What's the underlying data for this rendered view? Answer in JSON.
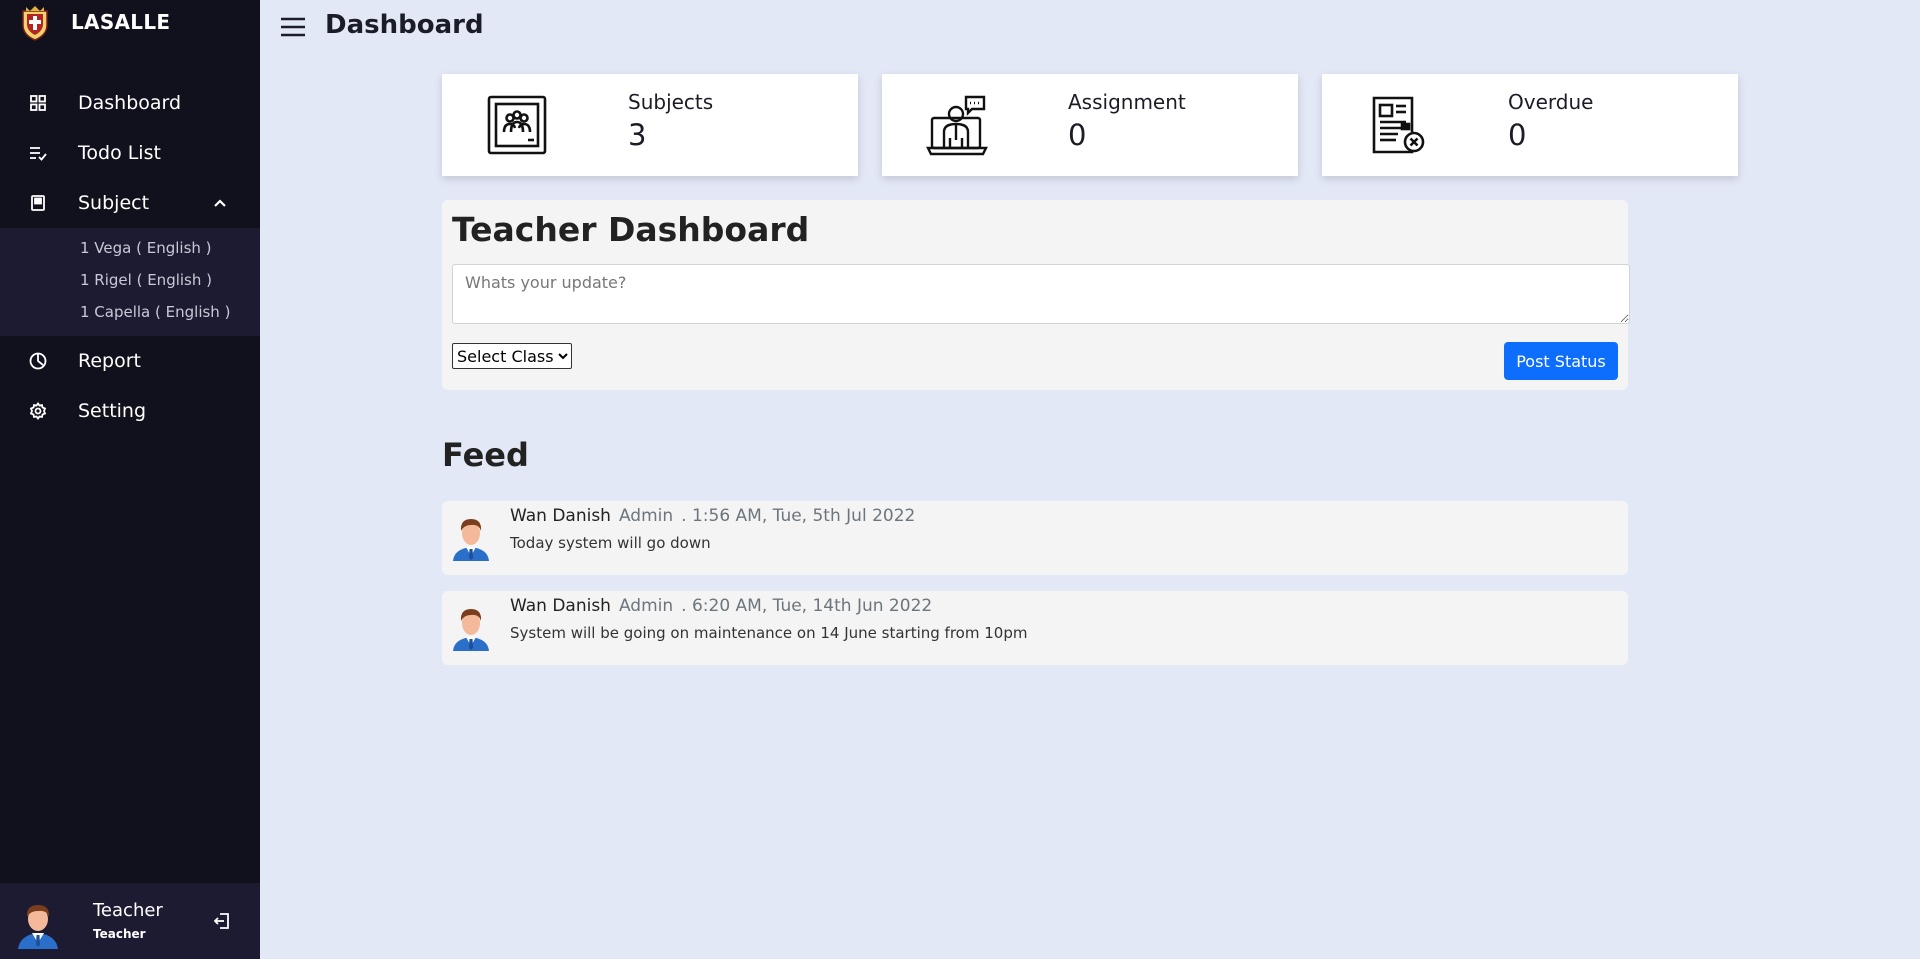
{
  "brand": {
    "name": "LASALLE"
  },
  "sidebar": {
    "items": [
      {
        "label": "Dashboard",
        "icon": "grid-icon"
      },
      {
        "label": "Todo List",
        "icon": "list-check-icon"
      },
      {
        "label": "Subject",
        "icon": "book-icon",
        "expanded": true
      },
      {
        "label": "Report",
        "icon": "pie-chart-icon"
      },
      {
        "label": "Setting",
        "icon": "gear-icon"
      }
    ],
    "subject_items": [
      "1 Vega ( English )",
      "1 Rigel ( English )",
      "1 Capella ( English )"
    ],
    "profile": {
      "name": "Teacher",
      "role": "Teacher"
    }
  },
  "header": {
    "title": "Dashboard"
  },
  "cards": [
    {
      "label": "Subjects",
      "value": "3",
      "icon": "class-frame-icon"
    },
    {
      "label": "Assignment",
      "value": "0",
      "icon": "online-teacher-icon"
    },
    {
      "label": "Overdue",
      "value": "0",
      "icon": "document-cancel-icon"
    }
  ],
  "teacher_panel": {
    "title": "Teacher Dashboard",
    "placeholder": "Whats your update?",
    "select_label": "Select Class",
    "post_label": "Post Status"
  },
  "feed": {
    "title": "Feed",
    "items": [
      {
        "author": "Wan Danish",
        "role": "Admin",
        "time": ". 1:56 AM, Tue, 5th Jul 2022",
        "text": "Today system will go down"
      },
      {
        "author": "Wan Danish",
        "role": "Admin",
        "time": ". 6:20 AM, Tue, 14th Jun 2022",
        "text": "System will be going on maintenance on 14 June starting from 10pm"
      }
    ]
  },
  "colors": {
    "sidebar_bg": "#11101d",
    "submenu_bg": "#1d1b31",
    "page_bg": "#e3e8f7",
    "primary": "#0d6efd"
  }
}
